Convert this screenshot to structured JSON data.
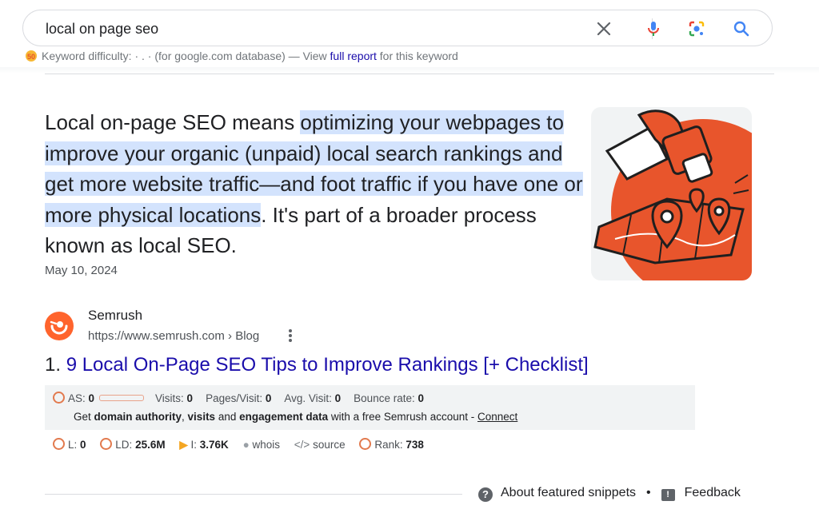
{
  "search": {
    "query": "local on page seo"
  },
  "icons": {
    "clear": "close-icon",
    "voice": "microphone-icon",
    "lens": "lens-icon",
    "search": "search-icon"
  },
  "keyword": {
    "prefix": "Keyword difficulty: ",
    "value": "· . ·",
    "middle": " (for google.com database) — View ",
    "link": "full report",
    "suffix": " for this keyword"
  },
  "snippet": {
    "lead": "Local on-page SEO means ",
    "highlight": "optimizing your webpages to improve your organic (unpaid) local search rankings and get more website traffic—and foot traffic if you have one or more physical locations",
    "tail": ". It's part of a broader process known as local SEO.",
    "date": "May 10, 2024"
  },
  "result": {
    "site": "Semrush",
    "url": "https://www.semrush.com › Blog",
    "number": "1. ",
    "title": "9 Local On-Page SEO Tips to Improve Rankings [+ Checklist]"
  },
  "semrush": {
    "as_label": "AS: ",
    "as_value": "0",
    "visits_label": "Visits: ",
    "visits_value": "0",
    "pages_label": "Pages/Visit: ",
    "pages_value": "0",
    "avg_label": "Avg. Visit: ",
    "avg_value": "0",
    "bounce_label": "Bounce rate: ",
    "bounce_value": "0",
    "cta_pre": "Get ",
    "cta_b1": "domain authority",
    "cta_mid1": ", ",
    "cta_b2": "visits",
    "cta_mid2": " and ",
    "cta_b3": "engagement data",
    "cta_post": " with a free Semrush account - ",
    "connect": "Connect",
    "l_label": "L: ",
    "l_value": "0",
    "ld_label": "LD: ",
    "ld_value": "25.6M",
    "i_label": "I: ",
    "i_value": "3.76K",
    "whois": "whois",
    "source": "source",
    "rank_label": "Rank: ",
    "rank_value": "738"
  },
  "footer": {
    "about": "About featured snippets",
    "separator": "•",
    "feedback": "Feedback"
  },
  "colors": {
    "link": "#1a0dab",
    "highlight": "#d3e3fd",
    "semrush": "#ff642d"
  }
}
